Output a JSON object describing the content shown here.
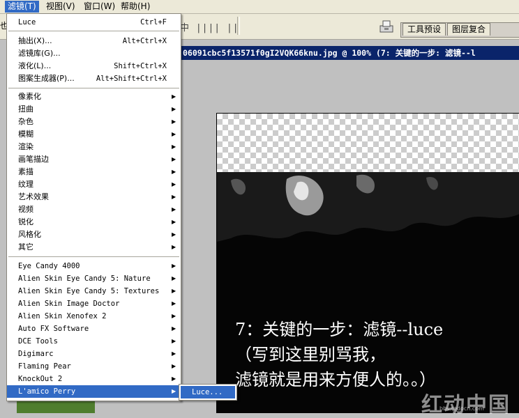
{
  "menubar": {
    "items": [
      {
        "label": "滤镜(T)"
      },
      {
        "label": "视图(V)"
      },
      {
        "label": "窗口(W)"
      },
      {
        "label": "帮助(H)"
      }
    ]
  },
  "toolbar": {
    "left_edge_text": "也",
    "align_glyphs": "中 |||| ||",
    "tabs": [
      {
        "label": "工具预设"
      },
      {
        "label": "图层复合"
      }
    ]
  },
  "document": {
    "title": "06091cbc5f13571f0gI2VQK66knu.jpg @ 100% (7: 关键的一步: 滤镜--l",
    "canvas_text": [
      "7：关键的一步：滤镜--luce",
      "（写到这里别骂我，",
      "滤镜就是用来方便人的。。）"
    ],
    "watermark": "红动中国",
    "watermark_url": "bbs.redocn.com"
  },
  "filter_menu": {
    "top_item": {
      "label": "Luce",
      "shortcut": "Ctrl+F"
    },
    "group1": [
      {
        "label": "抽出(X)...",
        "shortcut": "Alt+Ctrl+X"
      },
      {
        "label": "滤镜库(G)...",
        "shortcut": ""
      },
      {
        "label": "液化(L)...",
        "shortcut": "Shift+Ctrl+X"
      },
      {
        "label": "图案生成器(P)...",
        "shortcut": "Alt+Shift+Ctrl+X"
      }
    ],
    "group2": [
      {
        "label": "像素化"
      },
      {
        "label": "扭曲"
      },
      {
        "label": "杂色"
      },
      {
        "label": "模糊"
      },
      {
        "label": "渲染"
      },
      {
        "label": "画笔描边"
      },
      {
        "label": "素描"
      },
      {
        "label": "纹理"
      },
      {
        "label": "艺术效果"
      },
      {
        "label": "视频"
      },
      {
        "label": "锐化"
      },
      {
        "label": "风格化"
      },
      {
        "label": "其它"
      }
    ],
    "group3": [
      {
        "label": " Eye Candy 4000"
      },
      {
        "label": "Alien Skin Eye Candy 5: Nature"
      },
      {
        "label": "Alien Skin Eye Candy 5: Textures"
      },
      {
        "label": "Alien Skin Image Doctor"
      },
      {
        "label": "Alien Skin Xenofex 2"
      },
      {
        "label": "Auto FX Software"
      },
      {
        "label": "DCE Tools"
      },
      {
        "label": "Digimarc"
      },
      {
        "label": "Flaming Pear"
      },
      {
        "label": "KnockOut 2"
      },
      {
        "label": "L'amico Perry"
      }
    ],
    "submenu_item": {
      "label": "Luce..."
    }
  }
}
